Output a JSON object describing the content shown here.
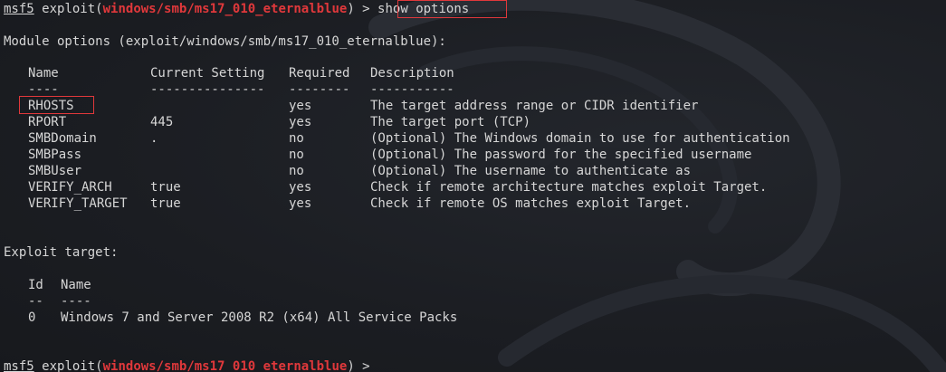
{
  "prompt": {
    "msf": "msf5",
    "exploit_word": "exploit",
    "paren_open": "(",
    "module": "windows/smb/ms17_010_eternalblue",
    "paren_close_arrow": ") > ",
    "command": "show options"
  },
  "module_options_title": "Module options (exploit/windows/smb/ms17_010_eternalblue):",
  "options_table": {
    "headers": [
      "Name",
      "Current Setting",
      "Required",
      "Description"
    ],
    "separators": [
      "----",
      "---------------",
      "--------",
      "-----------"
    ],
    "rows": [
      {
        "name": "RHOSTS",
        "current": "",
        "required": "yes",
        "description": "The target address range or CIDR identifier"
      },
      {
        "name": "RPORT",
        "current": "445",
        "required": "yes",
        "description": "The target port (TCP)"
      },
      {
        "name": "SMBDomain",
        "current": ".",
        "required": "no",
        "description": "(Optional) The Windows domain to use for authentication"
      },
      {
        "name": "SMBPass",
        "current": "",
        "required": "no",
        "description": "(Optional) The password for the specified username"
      },
      {
        "name": "SMBUser",
        "current": "",
        "required": "no",
        "description": "(Optional) The username to authenticate as"
      },
      {
        "name": "VERIFY_ARCH",
        "current": "true",
        "required": "yes",
        "description": "Check if remote architecture matches exploit Target."
      },
      {
        "name": "VERIFY_TARGET",
        "current": "true",
        "required": "yes",
        "description": "Check if remote OS matches exploit Target."
      }
    ]
  },
  "exploit_target_title": "Exploit target:",
  "target_table": {
    "headers": [
      "Id",
      "Name"
    ],
    "separators": [
      "--",
      "----"
    ],
    "rows": [
      {
        "id": "0",
        "name": "Windows 7 and Server 2008 R2 (x64) All Service Packs"
      }
    ]
  },
  "colors": {
    "background": "#1b1d22",
    "text": "#d6d6d6",
    "accent_red": "#e0383b"
  }
}
